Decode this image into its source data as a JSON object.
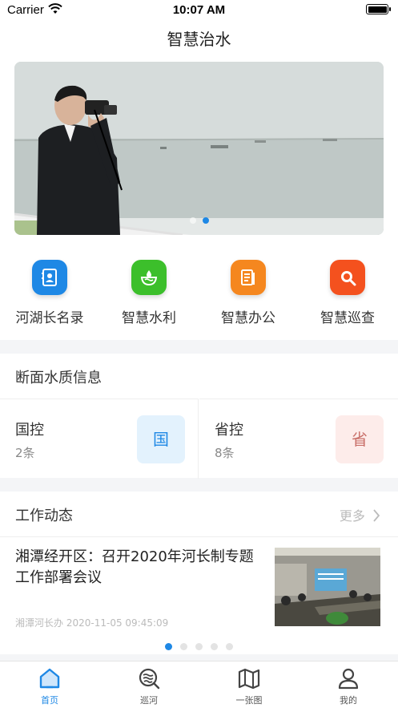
{
  "status_bar": {
    "carrier": "Carrier",
    "time": "10:07 AM"
  },
  "page": {
    "title": "智慧治水"
  },
  "banner": {
    "slides": 2,
    "active_slide": 2
  },
  "quick_actions": [
    {
      "label": "河湖长名录",
      "icon": "directory-icon",
      "color": "#1e88e5"
    },
    {
      "label": "智慧水利",
      "icon": "water-drop-icon",
      "color": "#3cbf2b"
    },
    {
      "label": "智慧办公",
      "icon": "document-icon",
      "color": "#f5871f"
    },
    {
      "label": "智慧巡查",
      "icon": "search-icon",
      "color": "#f4511e"
    }
  ],
  "water_quality": {
    "title": "断面水质信息",
    "cards": [
      {
        "name": "国控",
        "count": "2条",
        "tag": "国",
        "tag_color": "#1e88e5",
        "tag_bg": "#e3f2fd"
      },
      {
        "name": "省控",
        "count": "8条",
        "tag": "省",
        "tag_color": "#c9706a",
        "tag_bg": "#fdecea"
      }
    ]
  },
  "news": {
    "title": "工作动态",
    "more_label": "更多",
    "item": {
      "title": "湘潭经开区：召开2020年河长制专题工作部署会议",
      "source": "湘潭河长办",
      "date": "2020-11-05 09:45:09"
    },
    "pages": 5,
    "active_page": 1
  },
  "tabbar": {
    "active_color": "#1e88e5",
    "tabs": [
      {
        "label": "首页",
        "icon": "home-icon",
        "active": true
      },
      {
        "label": "巡河",
        "icon": "river-patrol-icon",
        "active": false
      },
      {
        "label": "一张图",
        "icon": "map-icon",
        "active": false
      },
      {
        "label": "我的",
        "icon": "profile-icon",
        "active": false
      }
    ]
  }
}
